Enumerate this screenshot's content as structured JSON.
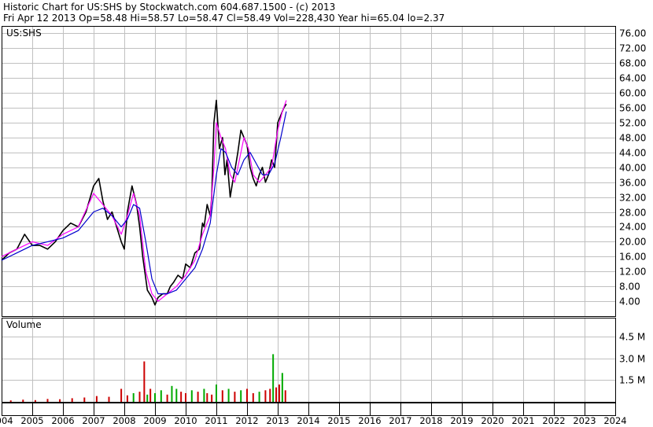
{
  "header": {
    "title": "Historic Chart for US:SHS by Stockwatch.com 604.687.1500 - (c) 2013",
    "quote": "Fri Apr 12 2013   Op=58.48  Hi=58.57  Lo=58.47  Cl=58.49  Vol=228,430   Year hi=65.04  lo=2.37"
  },
  "price_panel": {
    "symbol": "US:SHS"
  },
  "volume_panel": {
    "title": "Volume"
  },
  "chart_data": [
    {
      "type": "line",
      "title": "US:SHS",
      "xlabel": "",
      "ylabel": "",
      "grid": true,
      "ylim": [
        0,
        78
      ],
      "yticks": [
        4,
        8,
        12,
        16,
        20,
        24,
        28,
        32,
        36,
        40,
        44,
        48,
        52,
        56,
        60,
        64,
        68,
        72,
        76
      ],
      "ytick_labels": [
        "4.00",
        "8.00",
        "12.00",
        "16.00",
        "20.00",
        "24.00",
        "28.00",
        "32.00",
        "36.00",
        "40.00",
        "44.00",
        "48.00",
        "52.00",
        "56.00",
        "60.00",
        "64.00",
        "68.00",
        "72.00",
        "76.00"
      ],
      "x_tick_labels": [
        "2004",
        "2005",
        "2006",
        "2007",
        "2008",
        "2009",
        "2010",
        "2011",
        "2012",
        "2013",
        "2014",
        "2015",
        "2016",
        "2017",
        "2018",
        "2019",
        "2020",
        "2021",
        "2022",
        "2023",
        "2024"
      ],
      "xlim": [
        2004,
        2024
      ],
      "series": [
        {
          "color": "#000000",
          "x": [
            2004.0,
            2004.25,
            2004.5,
            2004.75,
            2005.0,
            2005.25,
            2005.5,
            2005.75,
            2006.0,
            2006.25,
            2006.5,
            2006.75,
            2007.0,
            2007.17,
            2007.3,
            2007.45,
            2007.6,
            2007.75,
            2007.9,
            2008.0,
            2008.1,
            2008.25,
            2008.4,
            2008.5,
            2008.6,
            2008.75,
            2008.9,
            2009.0,
            2009.1,
            2009.25,
            2009.4,
            2009.5,
            2009.6,
            2009.75,
            2009.9,
            2010.0,
            2010.15,
            2010.3,
            2010.45,
            2010.55,
            2010.6,
            2010.7,
            2010.8,
            2010.85,
            2010.92,
            2011.0,
            2011.1,
            2011.2,
            2011.28,
            2011.35,
            2011.45,
            2011.55,
            2011.62,
            2011.7,
            2011.8,
            2011.9,
            2012.0,
            2012.1,
            2012.2,
            2012.3,
            2012.4,
            2012.5,
            2012.6,
            2012.7,
            2012.8,
            2012.9,
            2013.0,
            2013.1,
            2013.2,
            2013.28
          ],
          "values": [
            15,
            17,
            18,
            22,
            19,
            19,
            18,
            20,
            23,
            25,
            24,
            28,
            35,
            37,
            31,
            26,
            28,
            24,
            20,
            18,
            28,
            35,
            30,
            24,
            16,
            7,
            5,
            3,
            5,
            6,
            6,
            8,
            9,
            11,
            10,
            14,
            13,
            17,
            18,
            25,
            24,
            30,
            27,
            32,
            52,
            58,
            45,
            48,
            38,
            42,
            32,
            37,
            40,
            44,
            50,
            48,
            46,
            40,
            37,
            35,
            38,
            40,
            36,
            38,
            42,
            40,
            52,
            54,
            56,
            57
          ]
        },
        {
          "name": "",
          "color": "#ff00ff",
          "x": [
            2004.0,
            2004.5,
            2005.0,
            2005.5,
            2006.0,
            2006.5,
            2007.0,
            2007.3,
            2007.6,
            2007.9,
            2008.1,
            2008.3,
            2008.5,
            2008.7,
            2008.9,
            2009.1,
            2009.4,
            2009.7,
            2010.0,
            2010.3,
            2010.55,
            2010.8,
            2010.92,
            2011.0,
            2011.15,
            2011.3,
            2011.45,
            2011.6,
            2011.75,
            2011.9,
            2012.05,
            2012.2,
            2012.4,
            2012.6,
            2012.8,
            2013.0,
            2013.15,
            2013.28
          ],
          "values": [
            16,
            18,
            20,
            19,
            22,
            24,
            33,
            30,
            27,
            22,
            27,
            33,
            27,
            12,
            6,
            4,
            6,
            8,
            11,
            15,
            22,
            27,
            40,
            52,
            48,
            45,
            38,
            36,
            42,
            48,
            45,
            38,
            36,
            38,
            40,
            50,
            55,
            58
          ]
        },
        {
          "name": "",
          "color": "#0000cc",
          "x": [
            2004.0,
            2004.5,
            2005.0,
            2005.5,
            2006.0,
            2006.5,
            2007.0,
            2007.3,
            2007.6,
            2007.9,
            2008.1,
            2008.3,
            2008.5,
            2008.7,
            2008.9,
            2009.1,
            2009.4,
            2009.7,
            2010.0,
            2010.3,
            2010.55,
            2010.8,
            2011.0,
            2011.15,
            2011.3,
            2011.5,
            2011.7,
            2011.9,
            2012.1,
            2012.3,
            2012.5,
            2012.7,
            2012.9,
            2013.1,
            2013.28
          ],
          "values": [
            15,
            17,
            19,
            20,
            21,
            23,
            28,
            29,
            27,
            24,
            26,
            30,
            29,
            20,
            10,
            6,
            6,
            7,
            10,
            13,
            18,
            25,
            38,
            45,
            44,
            40,
            38,
            42,
            44,
            41,
            38,
            38,
            41,
            48,
            55
          ]
        }
      ]
    },
    {
      "type": "bar",
      "title": "Volume",
      "ylim": [
        0,
        5500000
      ],
      "yticks": [
        1500000,
        3000000,
        4500000
      ],
      "ytick_labels": [
        "1.5 M",
        "3.0 M",
        "4.5 M"
      ],
      "x": [
        2004.3,
        2004.7,
        2005.1,
        2005.5,
        2005.9,
        2006.3,
        2006.7,
        2007.1,
        2007.5,
        2007.9,
        2008.1,
        2008.3,
        2008.5,
        2008.65,
        2008.75,
        2008.85,
        2009.0,
        2009.2,
        2009.4,
        2009.55,
        2009.7,
        2009.85,
        2010.0,
        2010.2,
        2010.4,
        2010.6,
        2010.7,
        2010.85,
        2011.0,
        2011.2,
        2011.4,
        2011.6,
        2011.8,
        2012.0,
        2012.2,
        2012.4,
        2012.6,
        2012.75,
        2012.85,
        2012.95,
        2013.05,
        2013.15,
        2013.25
      ],
      "values": [
        100000,
        150000,
        120000,
        200000,
        180000,
        250000,
        300000,
        400000,
        350000,
        900000,
        450000,
        600000,
        700000,
        2800000,
        500000,
        900000,
        600000,
        800000,
        500000,
        1100000,
        900000,
        700000,
        600000,
        800000,
        700000,
        900000,
        600000,
        500000,
        1200000,
        800000,
        900000,
        700000,
        800000,
        900000,
        600000,
        700000,
        800000,
        900000,
        3300000,
        1000000,
        1200000,
        2000000,
        800000
      ],
      "colors": [
        "#cc0000",
        "#cc0000",
        "#cc0000",
        "#cc0000",
        "#cc0000",
        "#cc0000",
        "#cc0000",
        "#cc0000",
        "#cc0000",
        "#cc0000",
        "#cc0000",
        "#00aa00",
        "#cc0000",
        "#cc0000",
        "#00aa00",
        "#cc0000",
        "#00aa00",
        "#00aa00",
        "#cc0000",
        "#00aa00",
        "#00aa00",
        "#cc0000",
        "#cc0000",
        "#00aa00",
        "#cc0000",
        "#00aa00",
        "#cc0000",
        "#cc0000",
        "#00aa00",
        "#cc0000",
        "#00aa00",
        "#cc0000",
        "#00aa00",
        "#cc0000",
        "#cc0000",
        "#00aa00",
        "#cc0000",
        "#cc0000",
        "#00aa00",
        "#cc0000",
        "#cc0000",
        "#00aa00",
        "#cc0000"
      ]
    }
  ]
}
